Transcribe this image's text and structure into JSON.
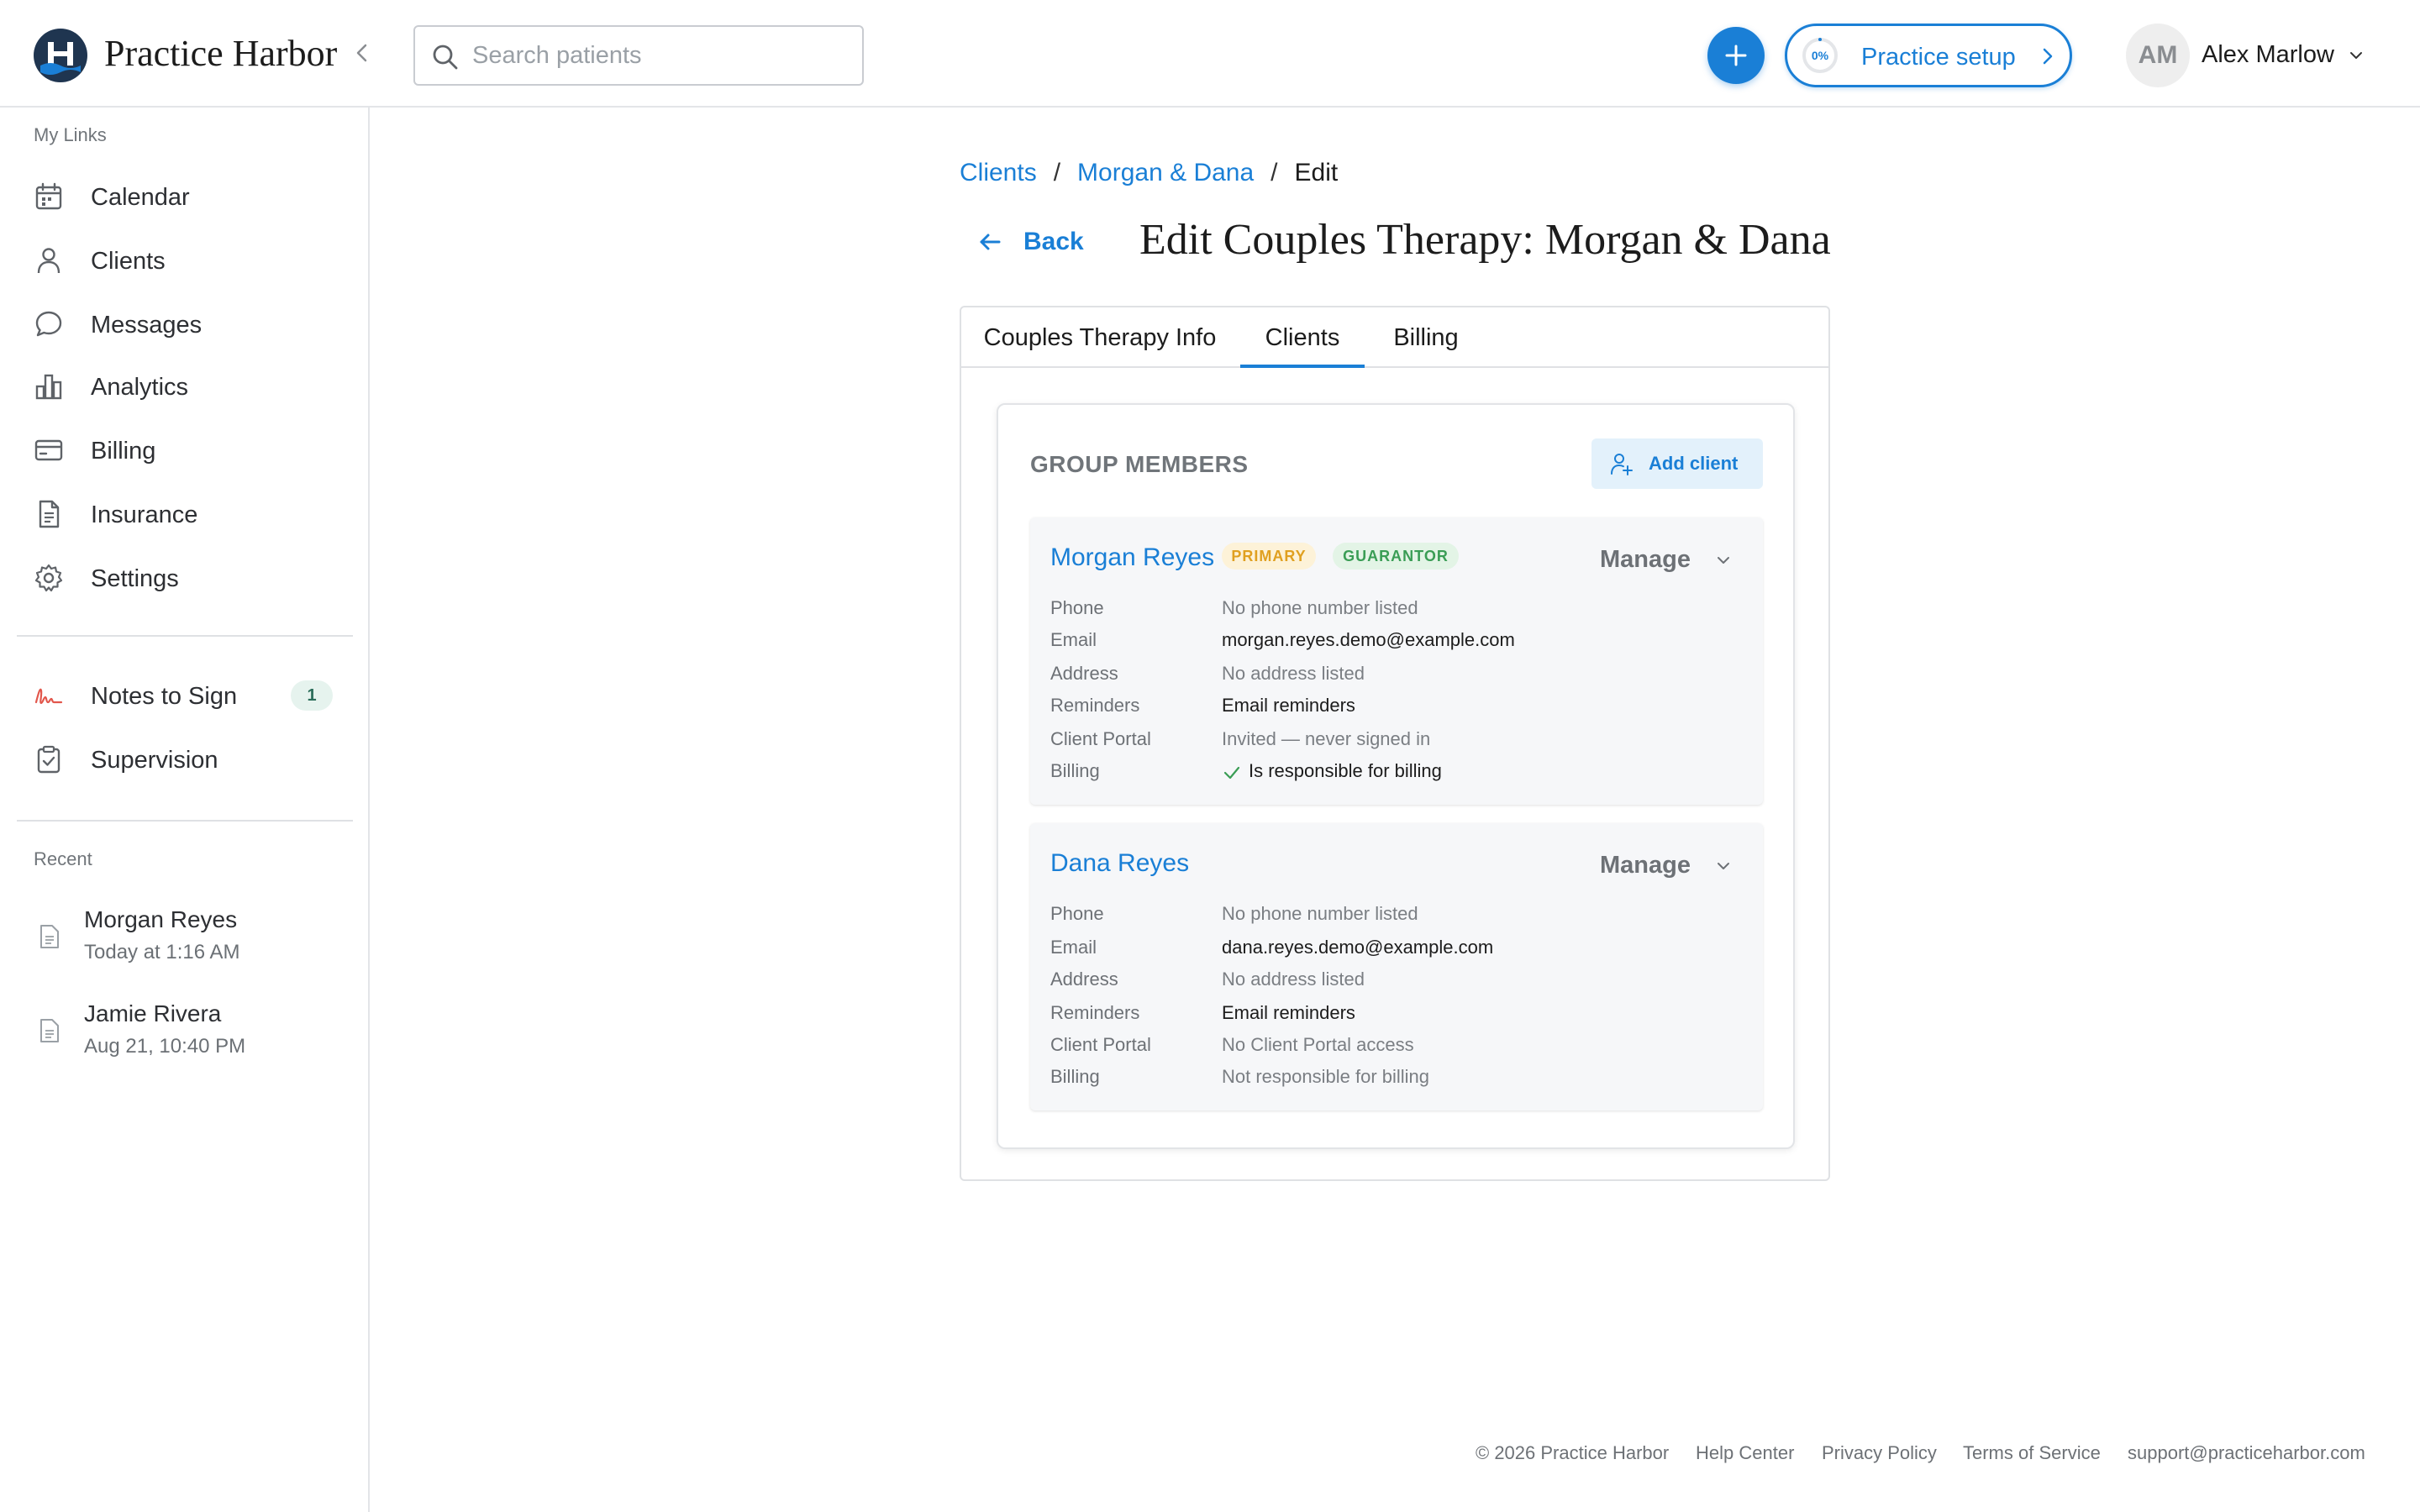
{
  "header": {
    "brand": "Practice Harbor",
    "search_placeholder": "Search patients",
    "setup_progress": "0%",
    "setup_label": "Practice setup",
    "user_initials": "AM",
    "user_name": "Alex Marlow",
    "accent_color": "#1a7fd6"
  },
  "sidebar": {
    "links_heading": "My Links",
    "items": [
      {
        "label": "Calendar",
        "icon": "calendar-icon"
      },
      {
        "label": "Clients",
        "icon": "person-icon"
      },
      {
        "label": "Messages",
        "icon": "chat-bubble-icon"
      },
      {
        "label": "Analytics",
        "icon": "bar-chart-icon"
      },
      {
        "label": "Billing",
        "icon": "credit-card-icon"
      },
      {
        "label": "Insurance",
        "icon": "document-icon"
      },
      {
        "label": "Settings",
        "icon": "gear-icon"
      }
    ],
    "tasks": [
      {
        "label": "Notes to Sign",
        "icon": "signature-icon",
        "count": "1"
      },
      {
        "label": "Supervision",
        "icon": "clipboard-check-icon"
      }
    ],
    "recent_heading": "Recent",
    "recent": [
      {
        "title": "Morgan Reyes",
        "time": "Today at 1:16 AM"
      },
      {
        "title": "Jamie Rivera",
        "time": "Aug 21, 10:40 PM"
      }
    ]
  },
  "main": {
    "breadcrumb": {
      "root": "Clients",
      "parent": "Morgan & Dana",
      "current": "Edit",
      "separator": "/"
    },
    "back_label": "Back",
    "title": "Edit Couples Therapy: Morgan & Dana",
    "tabs": [
      {
        "label": "Couples Therapy Info",
        "active": false
      },
      {
        "label": "Clients",
        "active": true
      },
      {
        "label": "Billing",
        "active": false
      }
    ],
    "group_heading": "GROUP MEMBERS",
    "add_client_label": "Add client",
    "manage_label": "Manage",
    "field_labels": {
      "phone": "Phone",
      "email": "Email",
      "address": "Address",
      "reminders": "Reminders",
      "portal": "Client Portal",
      "billing": "Billing"
    },
    "members": [
      {
        "name": "Morgan Reyes",
        "tags": [
          "PRIMARY",
          "GUARANTOR"
        ],
        "phone": "No phone number listed",
        "email": "morgan.reyes.demo@example.com",
        "address": "No address listed",
        "reminders": "Email reminders",
        "portal": "Invited — never signed in",
        "billing": "Is responsible for billing"
      },
      {
        "name": "Dana Reyes",
        "tags": [],
        "phone": "No phone number listed",
        "email": "dana.reyes.demo@example.com",
        "address": "No address listed",
        "reminders": "Email reminders",
        "portal": "No Client Portal access",
        "billing": "Not responsible for billing"
      }
    ]
  },
  "footer": {
    "copyright": "© 2026 Practice Harbor",
    "help": "Help Center",
    "privacy": "Privacy Policy",
    "terms": "Terms of Service",
    "email": "support@practiceharbor.com"
  }
}
